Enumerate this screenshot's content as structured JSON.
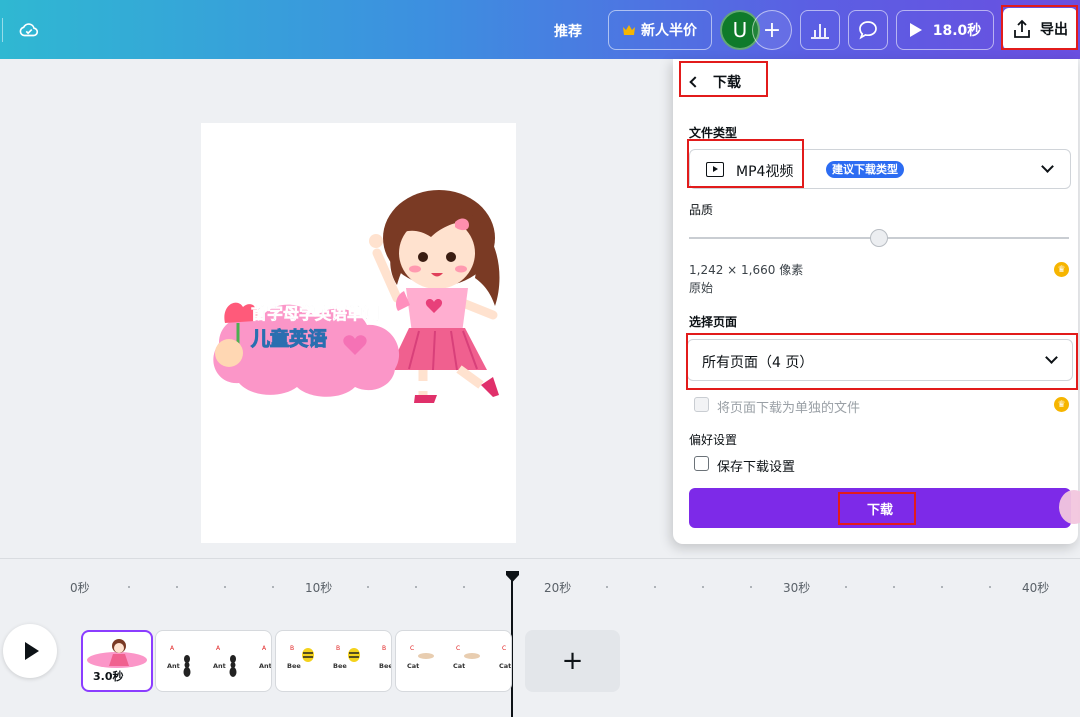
{
  "topbar": {
    "recommend_label": "推荐",
    "promo_label": "新人半价",
    "avatar_letter": "U",
    "add_label": "+",
    "play_duration": "18.0秒",
    "export_label": "导出"
  },
  "canvas": {
    "title_line1": "首字母学英语单词",
    "title_line2": "儿童英语"
  },
  "download_panel": {
    "back_label": "下载",
    "file_type_label": "文件类型",
    "file_type_value": "MP4视频",
    "file_type_badge": "建议下载类型",
    "quality_label": "品质",
    "quality_level": 0.5,
    "dimensions": "1,242 × 1,660 像素",
    "quality_preset": "原始",
    "select_pages_label": "选择页面",
    "select_pages_value": "所有页面（4 页）",
    "separate_files_label": "将页面下载为单独的文件",
    "preferences_label": "偏好设置",
    "save_settings_label": "保存下载设置",
    "download_button": "下载"
  },
  "timeline": {
    "ticks": [
      "0秒",
      "10秒",
      "20秒",
      "30秒",
      "40秒"
    ],
    "clips": [
      {
        "duration": "3.0秒",
        "letters": [],
        "words": []
      },
      {
        "letters": [
          "A",
          "A",
          "A"
        ],
        "words": [
          "Ant",
          "Ant",
          "Ant"
        ]
      },
      {
        "letters": [
          "B",
          "B",
          "B"
        ],
        "words": [
          "Bee",
          "Bee",
          "Bee"
        ]
      },
      {
        "letters": [
          "C",
          "C",
          "C"
        ],
        "words": [
          "Cat",
          "Cat",
          "Cat"
        ]
      }
    ],
    "add_label": "+"
  },
  "colors": {
    "accent": "#7d2ae8",
    "badge": "#2c6cf2",
    "highlight": "#e21b1b",
    "avatar": "#0f7a2a"
  },
  "icons": [
    "cloud-check-icon",
    "crown-icon",
    "stats-icon",
    "comment-icon",
    "play-icon",
    "export-upload-icon",
    "chevron-left-icon",
    "video-file-icon",
    "chevron-down-icon",
    "plus-icon"
  ]
}
